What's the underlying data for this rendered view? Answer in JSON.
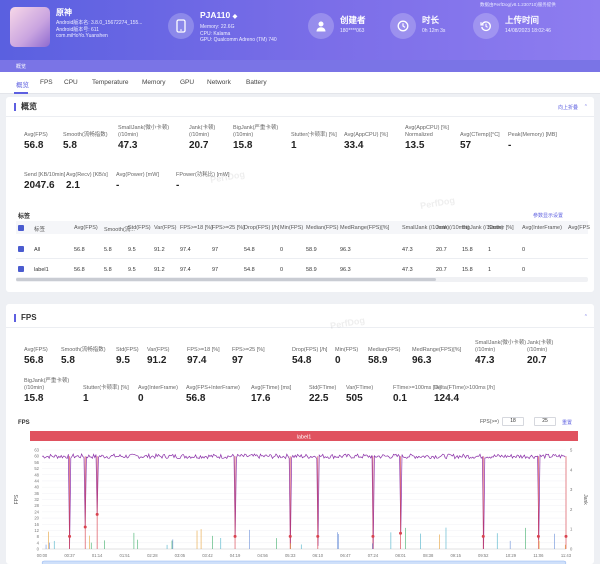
{
  "header": {
    "app_name": "原神",
    "app_version": "Android版本名: 3.8.0_15672274_155...",
    "app_code": "Android版本号: 611",
    "package": "com.miHoYo.Yuanshen",
    "device_model": "PJA110",
    "device_model_suffix": "◆",
    "memory": "Memory: 22.6G",
    "cpu": "CPU: Kalama",
    "gpu": "GPU: Qualcomm Adreno (TM) 740",
    "creator_label": "创建者",
    "creator_value": "180****063",
    "duration_label": "时长",
    "duration_value": "0h 12m 3s",
    "upload_label": "上传时间",
    "upload_value": "14/08/2023 18:02:46",
    "top_right_note": "数据由PerfDog(v8.1.230710)服务提供",
    "colors": {
      "gradient_start": "#5a60e0",
      "gradient_end": "#8e7df0"
    }
  },
  "nav": {
    "label": "概览"
  },
  "tabs": [
    "概览",
    "FPS",
    "CPU",
    "Temperature",
    "Memory",
    "GPU",
    "Network",
    "Battery"
  ],
  "overview": {
    "title": "概览",
    "collapse_label": "向上折叠",
    "metrics_row1": [
      {
        "label": "Avg(FPS)",
        "value": "56.8"
      },
      {
        "label": "Smooth(流畅指数)",
        "value": "5.8"
      },
      {
        "label": "SmallJank(微小卡顿)\n(/10min)",
        "value": "47.3"
      },
      {
        "label": "Jank(卡顿)\n(/10min)",
        "value": "20.7"
      },
      {
        "label": "BigJank(严重卡顿)\n(/10min)",
        "value": "15.8"
      },
      {
        "label": "Stutter(卡顿率) [%]",
        "value": "1"
      },
      {
        "label": "Avg(AppCPU) [%]",
        "value": "33.4"
      },
      {
        "label": "Avg(AppCPU) [%]\nNormalized",
        "value": "13.5"
      },
      {
        "label": "Avg(CTemp)[°C]",
        "value": "57"
      },
      {
        "label": "Peak(Memory) [MB]",
        "value": "-"
      }
    ],
    "metrics_row2": [
      {
        "label": "Send [KB/10min]",
        "value": "2047.6"
      },
      {
        "label": "Avg(Recv) [KB/s]",
        "value": "2.1"
      },
      {
        "label": "Avg(Power) [mW]",
        "value": "-"
      },
      {
        "label": "FPower(功耗比) [mW]",
        "value": "-"
      }
    ],
    "label_section": "标签",
    "label_settings": "参数显示设置",
    "table_headers": [
      "标签",
      "Avg(FPS)",
      "Smooth(流...",
      "Std(FPS)",
      "Var(FPS)",
      "FPS>=18 [%]",
      "FPS>=25 [%]",
      "Drop(FPS) [/h]",
      "Min(FPS)",
      "Median(FPS)",
      "MedRange(FPS)[%]",
      "SmallJank (/10min)",
      "Jank (/10min)",
      "BigJank (/10min)",
      "Stutter [%]",
      "Avg(InterFrame)",
      "Avg(FPS"
    ],
    "table_rows": [
      [
        "All",
        "56.8",
        "5.8",
        "9.5",
        "91.2",
        "97.4",
        "97",
        "54.8",
        "0",
        "58.9",
        "96.3",
        "47.3",
        "20.7",
        "15.8",
        "1",
        "0"
      ],
      [
        "label1",
        "56.8",
        "5.8",
        "9.5",
        "91.2",
        "97.4",
        "97",
        "54.8",
        "0",
        "58.9",
        "96.3",
        "47.3",
        "20.7",
        "15.8",
        "1",
        "0"
      ]
    ]
  },
  "fps": {
    "title": "FPS",
    "row1": [
      {
        "label": "Avg(FPS)",
        "value": "56.8"
      },
      {
        "label": "Smooth(流畅指数)",
        "value": "5.8"
      },
      {
        "label": "Std(FPS)",
        "value": "9.5"
      },
      {
        "label": "Var(FPS)",
        "value": "91.2"
      },
      {
        "label": "FPS>=18 [%]",
        "value": "97.4"
      },
      {
        "label": "FPS>=25 [%]",
        "value": "97"
      },
      {
        "label": "Drop(FPS) [/h]",
        "value": "54.8"
      },
      {
        "label": "Min(FPS)",
        "value": "0"
      },
      {
        "label": "Median(FPS)",
        "value": "58.9"
      },
      {
        "label": "MedRange(FPS)[%]",
        "value": "96.3"
      },
      {
        "label": "SmallJank(微小卡顿)\n(/10min)",
        "value": "47.3"
      },
      {
        "label": "Jank(卡顿)\n(/10min)",
        "value": "20.7"
      }
    ],
    "row2": [
      {
        "label": "BigJank(严重卡顿)\n(/10min)",
        "value": "15.8"
      },
      {
        "label": "Stutter(卡顿率) [%]",
        "value": "1"
      },
      {
        "label": "Avg(InterFrame)",
        "value": "0"
      },
      {
        "label": "Avg(FPS+InterFrame)",
        "value": "56.8"
      },
      {
        "label": "Avg(FTime) [ms]",
        "value": "17.6"
      },
      {
        "label": "Std(FTime)",
        "value": "22.5"
      },
      {
        "label": "Var(FTime)",
        "value": "505"
      },
      {
        "label": "FTime>=100ms [%]",
        "value": "0.1"
      },
      {
        "label": "Delta(FTime)>100ms [/h]",
        "value": "124.4"
      }
    ],
    "chart_title": "FPS",
    "threshold_label": "FPS(>=)",
    "threshold_1": "18",
    "threshold_2": "25",
    "reset_label": "重置",
    "band_label": "label1"
  },
  "chart_data": {
    "type": "line",
    "ylabel": "FPS",
    "y2label": "Jank",
    "yticks": [
      "63",
      "60",
      "56",
      "52",
      "48",
      "44",
      "40",
      "36",
      "32",
      "28",
      "24",
      "20",
      "16",
      "12",
      "8",
      "4",
      "0"
    ],
    "y2ticks": [
      "5",
      "4",
      "3",
      "2",
      "1",
      "0"
    ],
    "xticks": [
      "00:00",
      "00:37",
      "01:14",
      "01:51",
      "02:28",
      "03:05",
      "03:42",
      "04:19",
      "04:56",
      "05:33",
      "06:10",
      "06:47",
      "07:24",
      "08:01",
      "08:38",
      "09:15",
      "09:52",
      "10:29",
      "11:06",
      "11:43"
    ],
    "ylim": [
      0,
      63
    ],
    "legend": [
      "FPS",
      "Smooth",
      "SmallJank",
      "Jank",
      "BigJank",
      "Stutter",
      "InterFrame"
    ],
    "legend_colors": [
      "#8b2fa8",
      "#6a8fd8",
      "#3fae6a",
      "#e6a23c",
      "#d9434f",
      "#4ab0c8",
      "#7dbb5a"
    ],
    "fps_baseline": 59,
    "drop_points_min": [
      {
        "t": "00:37",
        "fps": 0
      },
      {
        "t": "00:58",
        "fps": 14
      },
      {
        "t": "01:14",
        "fps": 22
      },
      {
        "t": "04:19",
        "fps": 8
      },
      {
        "t": "05:33",
        "fps": 0
      },
      {
        "t": "06:10",
        "fps": 2
      },
      {
        "t": "07:24",
        "fps": 0
      },
      {
        "t": "08:01",
        "fps": 10
      },
      {
        "t": "09:52",
        "fps": 0
      },
      {
        "t": "11:06",
        "fps": 6
      },
      {
        "t": "11:43",
        "fps": 0
      }
    ]
  }
}
